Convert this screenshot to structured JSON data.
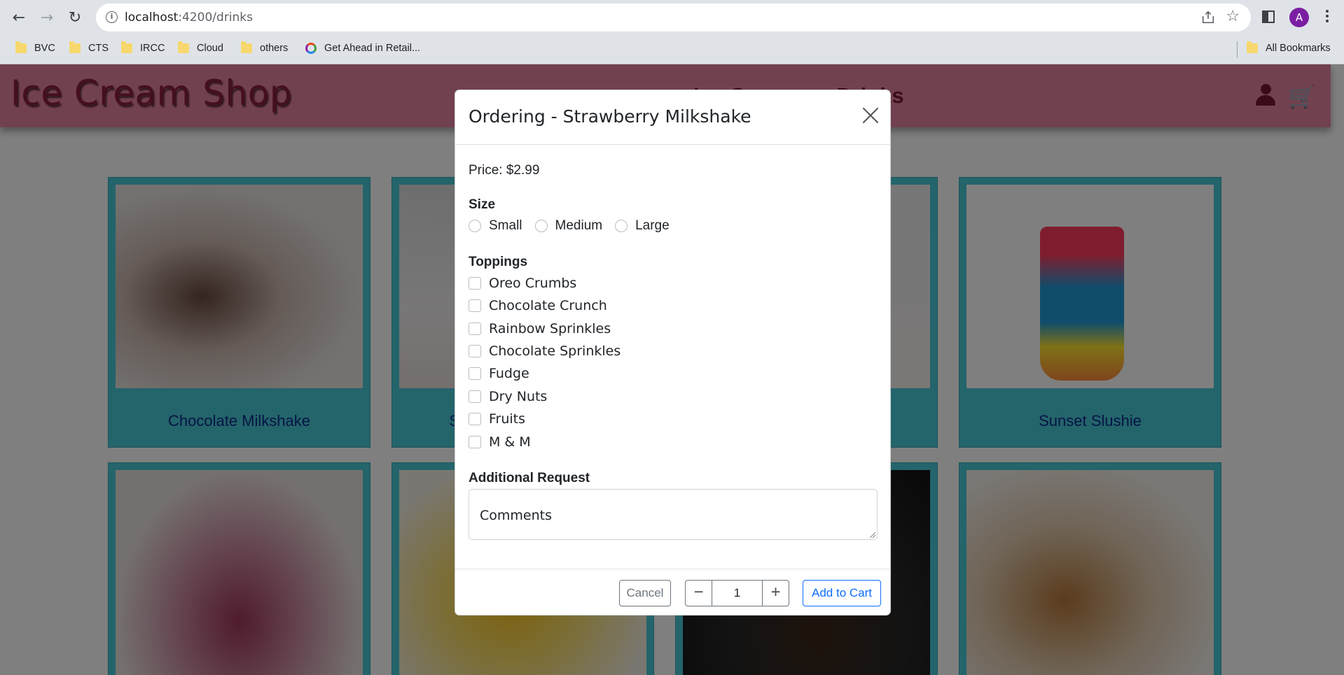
{
  "browser": {
    "url_host": "localhost",
    "url_path": ":4200/drinks",
    "avatar_letter": "A",
    "bookmarks": [
      "BVC",
      "CTS",
      "IRCC",
      "Cloud",
      "others",
      "Get Ahead in Retail..."
    ],
    "all_bookmarks": "All Bookmarks"
  },
  "site": {
    "title": "Ice Cream Shop",
    "nav": [
      "Ice Creams",
      "Drinks"
    ]
  },
  "cards": [
    "Chocolate Milkshake",
    "Strawberry Milkshake",
    "",
    "Sunset Slushie"
  ],
  "modal": {
    "title": "Ordering - Strawberry Milkshake",
    "price": "Price: $2.99",
    "size_label": "Size",
    "sizes": [
      "Small",
      "Medium",
      "Large"
    ],
    "toppings_label": "Toppings",
    "toppings": [
      "Oreo Crumbs",
      "Chocolate Crunch",
      "Rainbow Sprinkles",
      "Chocolate Sprinkles",
      "Fudge",
      "Dry Nuts",
      "Fruits",
      "M & M"
    ],
    "request_label": "Additional Request",
    "request_placeholder": "Comments",
    "cancel": "Cancel",
    "quantity": "1",
    "minus": "−",
    "plus": "+",
    "add_to_cart": "Add to Cart"
  },
  "colors": {
    "header": "#e5839f",
    "card": "#49c9d6",
    "primary": "#0d6efd"
  }
}
